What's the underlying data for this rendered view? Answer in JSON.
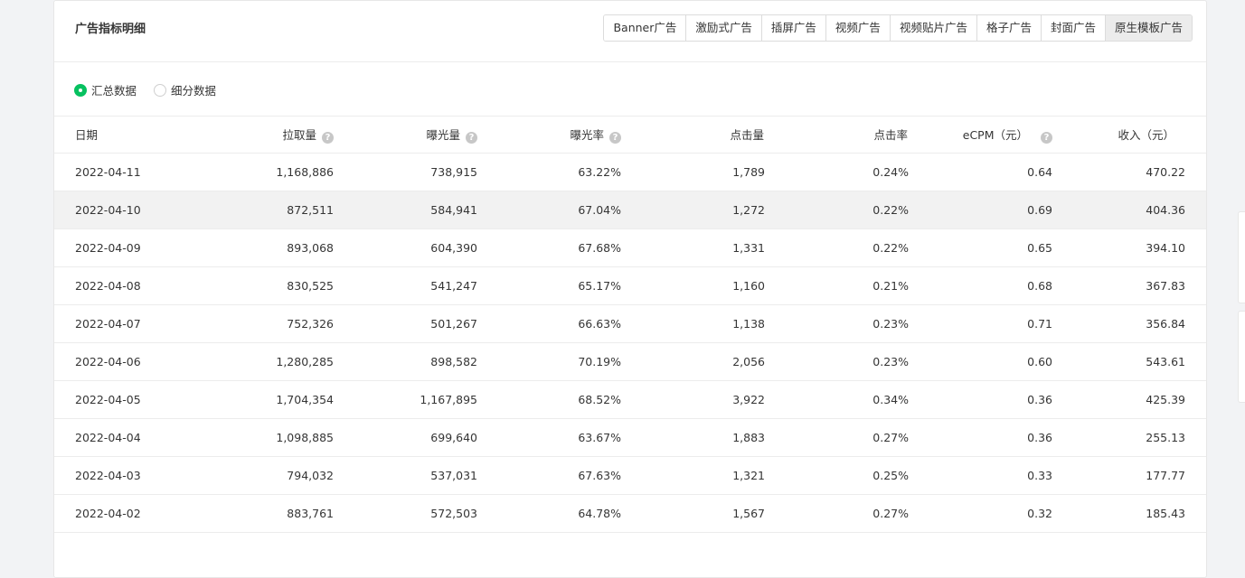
{
  "card": {
    "title": "广告指标明细"
  },
  "ad_tabs": [
    {
      "label": "Banner广告",
      "active": false
    },
    {
      "label": "激励式广告",
      "active": false
    },
    {
      "label": "插屏广告",
      "active": false
    },
    {
      "label": "视频广告",
      "active": false
    },
    {
      "label": "视频贴片广告",
      "active": false
    },
    {
      "label": "格子广告",
      "active": false
    },
    {
      "label": "封面广告",
      "active": false
    },
    {
      "label": "原生模板广告",
      "active": true
    }
  ],
  "filter": {
    "summary_label": "汇总数据",
    "detail_label": "细分数据",
    "selected": "summary"
  },
  "table": {
    "columns": {
      "date": "日期",
      "requests": "拉取量",
      "impressions": "曝光量",
      "impression_rate": "曝光率",
      "clicks": "点击量",
      "ctr": "点击率",
      "ecpm": "eCPM（元）",
      "revenue": "收入（元）"
    },
    "help_icon": "?",
    "rows": [
      [
        "2022-04-11",
        "1,168,886",
        "738,915",
        "63.22%",
        "1,789",
        "0.24%",
        "0.64",
        "470.22"
      ],
      [
        "2022-04-10",
        "872,511",
        "584,941",
        "67.04%",
        "1,272",
        "0.22%",
        "0.69",
        "404.36"
      ],
      [
        "2022-04-09",
        "893,068",
        "604,390",
        "67.68%",
        "1,331",
        "0.22%",
        "0.65",
        "394.10"
      ],
      [
        "2022-04-08",
        "830,525",
        "541,247",
        "65.17%",
        "1,160",
        "0.21%",
        "0.68",
        "367.83"
      ],
      [
        "2022-04-07",
        "752,326",
        "501,267",
        "66.63%",
        "1,138",
        "0.23%",
        "0.71",
        "356.84"
      ],
      [
        "2022-04-06",
        "1,280,285",
        "898,582",
        "70.19%",
        "2,056",
        "0.23%",
        "0.60",
        "543.61"
      ],
      [
        "2022-04-05",
        "1,704,354",
        "1,167,895",
        "68.52%",
        "3,922",
        "0.34%",
        "0.36",
        "425.39"
      ],
      [
        "2022-04-04",
        "1,098,885",
        "699,640",
        "63.67%",
        "1,883",
        "0.27%",
        "0.36",
        "255.13"
      ],
      [
        "2022-04-03",
        "794,032",
        "537,031",
        "67.63%",
        "1,321",
        "0.25%",
        "0.33",
        "177.77"
      ],
      [
        "2022-04-02",
        "883,761",
        "572,503",
        "64.78%",
        "1,567",
        "0.27%",
        "0.32",
        "185.43"
      ]
    ],
    "hovered_row": 1
  },
  "colors": {
    "accent_green": "#07c160",
    "active_tab_bg": "#ececec",
    "hover_row_bg": "#f2f2f2",
    "page_bg": "#f2f3f5"
  }
}
